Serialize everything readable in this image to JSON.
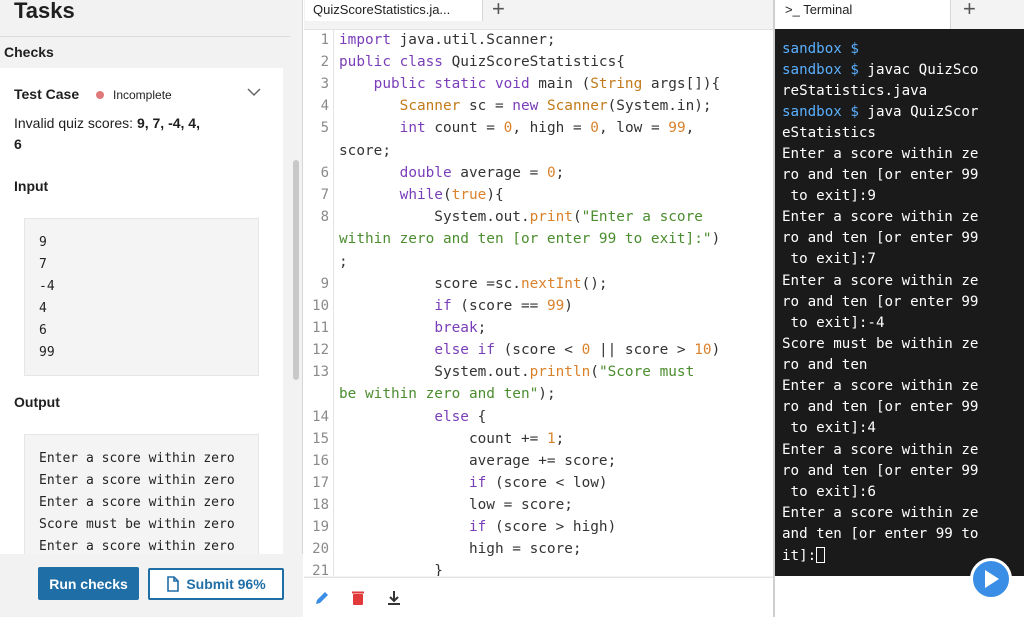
{
  "tasks": {
    "title": "Tasks",
    "checks_label": "Checks",
    "test_case": {
      "label": "Test Case",
      "status": "Incomplete",
      "desc_prefix": "Invalid quiz scores: ",
      "desc_values_1": "9, 7, -4, 4,",
      "desc_values_2": "6"
    },
    "input_label": "Input",
    "input_lines": [
      "9",
      "7",
      "-4",
      "4",
      "6",
      "99"
    ],
    "output_label": "Output",
    "output_lines": [
      "Enter a score within zero",
      "Enter a score within zero",
      "Enter a score within zero",
      "Score must be within zero",
      "Enter a score within zero"
    ],
    "run_label": "Run checks",
    "submit_label": "Submit 96%"
  },
  "editor": {
    "tab_label": "QuizScoreStatistics.ja...",
    "line_numbers": [
      "1",
      "2",
      "3",
      "4",
      "5",
      "",
      "6",
      "7",
      "8",
      "",
      "",
      "9",
      "10",
      "11",
      "12",
      "13",
      "",
      "14",
      "15",
      "16",
      "17",
      "18",
      "19",
      "20",
      "21"
    ]
  },
  "terminal": {
    "tab_label": ">_ Terminal",
    "prompt": "sandbox $",
    "lines": [
      "sandbox $",
      "sandbox $ javac QuizSco",
      "reStatistics.java",
      "sandbox $ java QuizScor",
      "eStatistics",
      "Enter a score within ze",
      "ro and ten [or enter 99",
      " to exit]:9",
      "Enter a score within ze",
      "ro and ten [or enter 99",
      " to exit]:7",
      "Enter a score within ze",
      "ro and ten [or enter 99",
      " to exit]:-4",
      "Score must be within ze",
      "ro and ten",
      "Enter a score within ze",
      "ro and ten [or enter 99",
      " to exit]:4",
      "Enter a score within ze",
      "ro and ten [or enter 99",
      " to exit]:6",
      "Enter a score within ze",
      "and ten [or enter 99 to",
      "it]:"
    ]
  },
  "colors": {
    "accent": "#1f6ea6",
    "incomplete_dot": "#e07a7a",
    "terminal_bg": "#1a1a1a",
    "prompt": "#5ab0ff"
  },
  "icons": [
    "chevron-down-icon",
    "file-icon",
    "pencil-icon",
    "trash-icon",
    "download-icon",
    "play-icon",
    "plus-icon"
  ]
}
